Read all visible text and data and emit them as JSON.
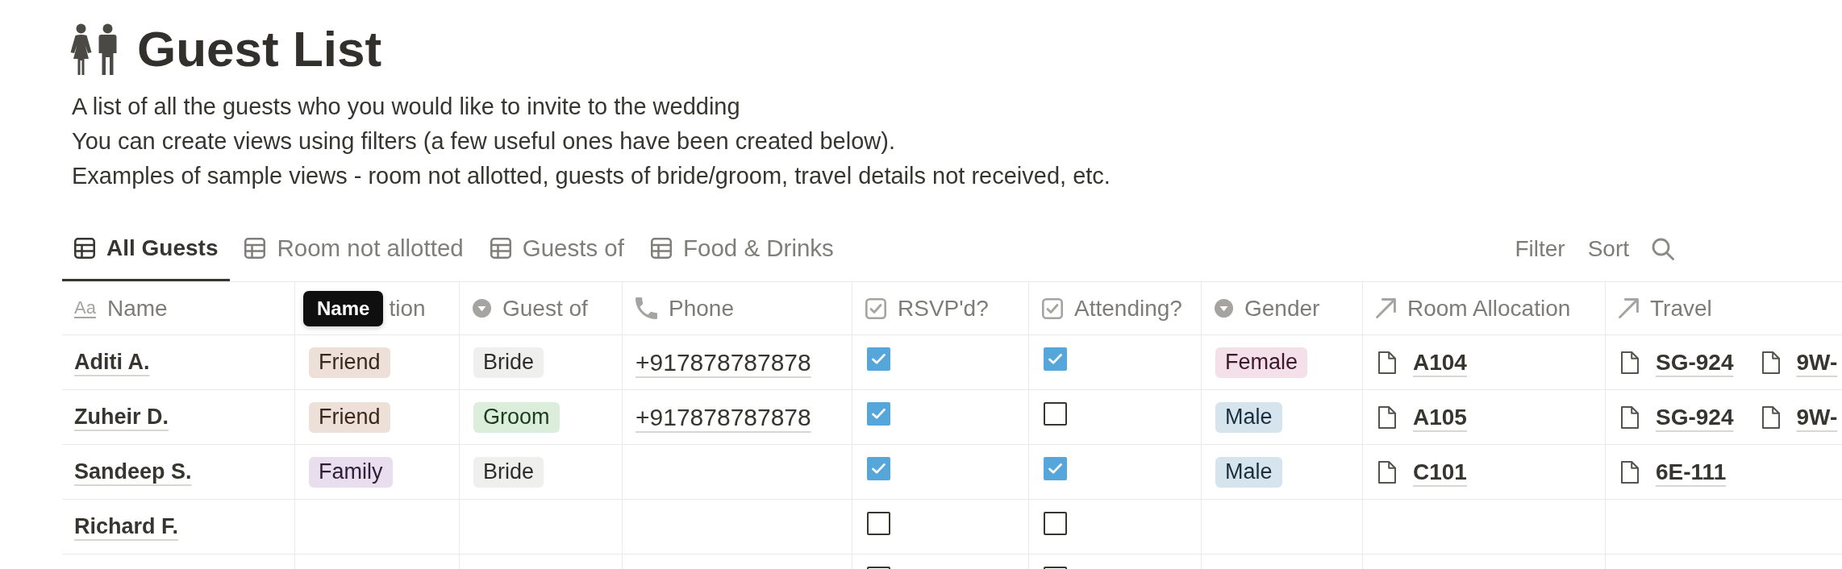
{
  "page": {
    "title": "Guest List",
    "description": [
      "A list of all the guests who you would like to invite to the wedding",
      "You can create views using filters (a few useful ones have been created below).",
      "Examples of sample views - room not allotted, guests of bride/groom, travel details not received, etc."
    ]
  },
  "views": {
    "tabs": [
      {
        "label": "All Guests",
        "selected": true
      },
      {
        "label": "Room not allotted",
        "selected": false
      },
      {
        "label": "Guests of",
        "selected": false
      },
      {
        "label": "Food & Drinks",
        "selected": false
      }
    ],
    "actions": [
      "Filter",
      "Sort"
    ]
  },
  "table": {
    "columns": [
      {
        "label": "Name",
        "kind": "title",
        "icon_text": "Aa"
      },
      {
        "label": "tion",
        "tooltip": "Name"
      },
      {
        "label": "Guest of",
        "kind": "select"
      },
      {
        "label": "Phone",
        "kind": "phone"
      },
      {
        "label": "RSVP'd?",
        "kind": "checkbox"
      },
      {
        "label": "Attending?",
        "kind": "checkbox"
      },
      {
        "label": "Gender",
        "kind": "select"
      },
      {
        "label": "Room Allocation",
        "kind": "relation"
      },
      {
        "label": "Travel",
        "kind": "relation"
      }
    ],
    "rows": [
      {
        "name": "Aditi A.",
        "column_2": {
          "label": "Friend",
          "color": "#ede0d9"
        },
        "guest_of": {
          "label": "Bride",
          "color": "#efefee"
        },
        "phone": "+917878787878",
        "rsvpd": true,
        "attending": true,
        "gender": {
          "label": "Female",
          "color": "#f4e0e9"
        },
        "room_allocation": [
          "A104"
        ],
        "travel": [
          "SG-924",
          "9W-"
        ]
      },
      {
        "name": "Zuheir D.",
        "column_2": {
          "label": "Friend",
          "color": "#ede0d9"
        },
        "guest_of": {
          "label": "Groom",
          "color": "#dbeddb"
        },
        "phone": "+917878787878",
        "rsvpd": true,
        "attending": false,
        "gender": {
          "label": "Male",
          "color": "#d6e4ee"
        },
        "room_allocation": [
          "A105"
        ],
        "travel": [
          "SG-924",
          "9W-"
        ]
      },
      {
        "name": "Sandeep S.",
        "column_2": {
          "label": "Family",
          "color": "#e8deee"
        },
        "guest_of": {
          "label": "Bride",
          "color": "#efefee"
        },
        "rsvpd": true,
        "attending": true,
        "gender": {
          "label": "Male",
          "color": "#d6e4ee"
        },
        "room_allocation": [
          "C101"
        ],
        "travel": [
          "6E-111"
        ]
      },
      {
        "name": "Richard F.",
        "rsvpd": false,
        "attending": false
      },
      {
        "rsvpd": false,
        "attending": false
      }
    ]
  }
}
